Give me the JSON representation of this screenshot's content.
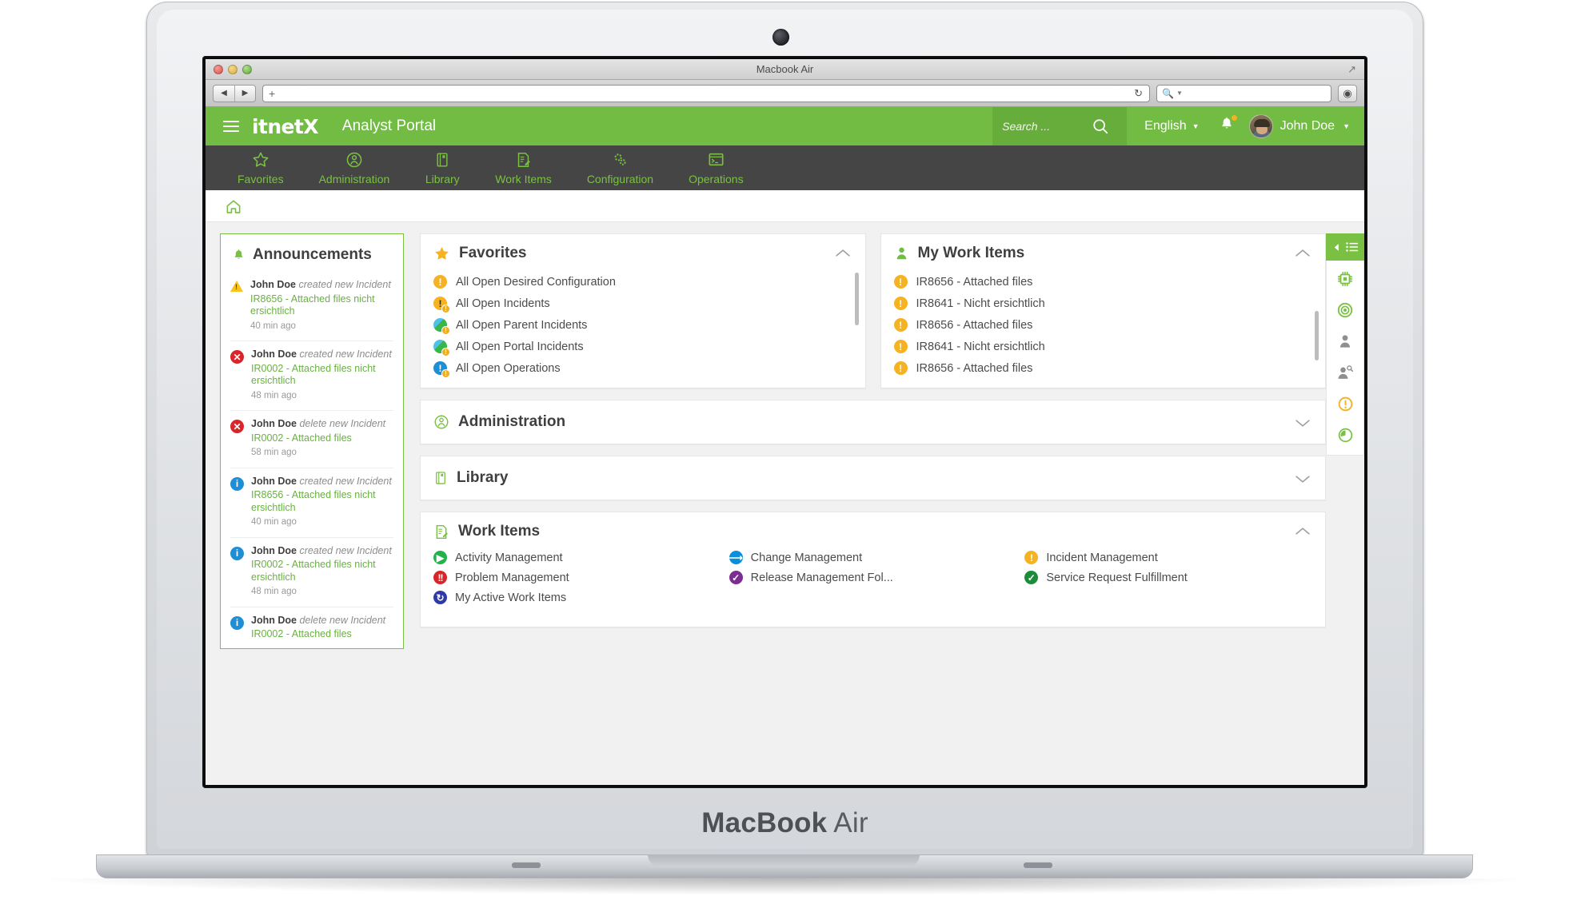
{
  "laptop": {
    "brand_bold": "MacBook",
    "brand_light": "Air"
  },
  "browser": {
    "window_title": "Macbook Air",
    "url_value": "",
    "url_placeholder": "",
    "search_value": "",
    "reload_icon": "reload-icon",
    "back_icon": "back-icon",
    "forward_icon": "forward-icon",
    "new_tab_icon": "new-tab-icon",
    "prefs_icon": "preferences-icon"
  },
  "topbar": {
    "menu_icon": "hamburger-menu-icon",
    "logo": "itnetX",
    "app_title": "Analyst Portal",
    "search_placeholder": "Search ...",
    "search_icon": "search-icon",
    "language": "English",
    "notifications_icon": "bell-icon",
    "user_name": "John Doe",
    "accent_green": "#72bc44",
    "search_green": "#67ad3c",
    "nav_dark": "#454545",
    "nav_green_text": "#7ac143"
  },
  "nav": {
    "items": [
      {
        "label": "Favorites",
        "icon": "star-outline-icon"
      },
      {
        "label": "Administration",
        "icon": "user-circle-icon"
      },
      {
        "label": "Library",
        "icon": "book-icon"
      },
      {
        "label": "Work Items",
        "icon": "document-edit-icon"
      },
      {
        "label": "Configuration",
        "icon": "gears-icon"
      },
      {
        "label": "Operations",
        "icon": "console-window-icon"
      }
    ]
  },
  "breadcrumb": {
    "home_icon": "home-icon"
  },
  "announcements": {
    "title": "Announcements",
    "icon": "bell-icon",
    "items": [
      {
        "icon": "warning-triangle-icon",
        "who": "John Doe",
        "action": "created new Incident",
        "subject": "IR8656 - Attached files nicht ersichtlich",
        "time": "40 min ago"
      },
      {
        "icon": "error-circle-icon",
        "who": "John Doe",
        "action": "created new Incident",
        "subject": "IR0002 - Attached files nicht ersichtlich",
        "time": "48 min ago"
      },
      {
        "icon": "error-circle-icon",
        "who": "John Doe",
        "action": "delete new Incident",
        "subject": "IR0002 - Attached files",
        "time": "58 min ago"
      },
      {
        "icon": "info-circle-icon",
        "who": "John Doe",
        "action": "created new Incident",
        "subject": "IR8656 - Attached files nicht ersichtlich",
        "time": "40 min ago"
      },
      {
        "icon": "info-circle-icon",
        "who": "John Doe",
        "action": "created new Incident",
        "subject": "IR0002 - Attached files nicht ersichtlich",
        "time": "48 min ago"
      },
      {
        "icon": "info-circle-icon",
        "who": "John Doe",
        "action": "delete new Incident",
        "subject": "IR0002 - Attached files",
        "time": ""
      }
    ]
  },
  "favorites": {
    "title": "Favorites",
    "icon": "star-filled-icon",
    "chevron": "chevron-up-icon",
    "items": [
      {
        "label": "All Open Desired Configuration",
        "icon": "warning-circle-icon"
      },
      {
        "label": "All Open Incidents",
        "icon": "warning-circle-overlay-icon"
      },
      {
        "label": "All Open Parent Incidents",
        "icon": "globe-overlay-icon"
      },
      {
        "label": "All Open Portal Incidents",
        "icon": "globe-overlay-icon"
      },
      {
        "label": "All Open Operations",
        "icon": "info-circle-overlay-icon"
      }
    ]
  },
  "my_work_items": {
    "title": "My Work Items",
    "icon": "person-icon",
    "chevron": "chevron-up-icon",
    "items": [
      {
        "label": "IR8656 - Attached files",
        "icon": "warning-circle-icon"
      },
      {
        "label": "IR8641 - Nicht ersichtlich",
        "icon": "warning-circle-icon"
      },
      {
        "label": "IR8656 - Attached files",
        "icon": "warning-circle-icon"
      },
      {
        "label": "IR8641 - Nicht ersichtlich",
        "icon": "warning-circle-icon"
      },
      {
        "label": "IR8656 - Attached files",
        "icon": "warning-circle-icon"
      }
    ]
  },
  "administration": {
    "title": "Administration",
    "icon": "user-circle-icon",
    "chevron": "chevron-down-icon"
  },
  "library": {
    "title": "Library",
    "icon": "book-icon",
    "chevron": "chevron-down-icon"
  },
  "work_items": {
    "title": "Work Items",
    "icon": "document-edit-icon",
    "chevron": "chevron-up-icon",
    "items": [
      {
        "label": "Activity Management",
        "icon": "play-circle-icon",
        "color": "#22b14c"
      },
      {
        "label": "Change Management",
        "icon": "arrow-circle-icon",
        "color": "#0d8ed9"
      },
      {
        "label": "Incident Management",
        "icon": "warning-circle-icon",
        "color": "#f5b324"
      },
      {
        "label": "Problem Management",
        "icon": "double-bang-icon",
        "color": "#d9252a"
      },
      {
        "label": "Release Management Fol...",
        "icon": "check-circle-icon",
        "color": "#7b2d91"
      },
      {
        "label": "Service Request Fulfillment",
        "icon": "diamond-check-icon",
        "color": "#1d8b3a"
      },
      {
        "label": "My Active Work Items",
        "icon": "refresh-circle-icon",
        "color": "#2e3aa8"
      }
    ]
  },
  "rail": {
    "collapse_icon": "collapse-left-icon",
    "list_icon": "list-icon",
    "icons": [
      {
        "name": "cpu-chip-icon",
        "color": "#7ac143"
      },
      {
        "name": "target-circle-icon",
        "color": "#7ac143"
      },
      {
        "name": "person-icon",
        "color": "#8f8f8f"
      },
      {
        "name": "person-search-icon",
        "color": "#8f8f8f"
      },
      {
        "name": "warning-circle-icon",
        "color": "#f5b324"
      },
      {
        "name": "clock-icon",
        "color": "#7ac143"
      }
    ]
  }
}
